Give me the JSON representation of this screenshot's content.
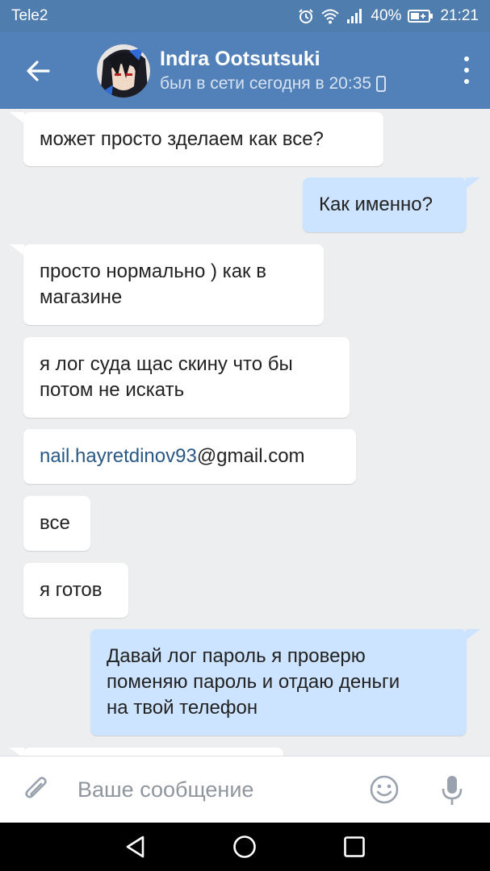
{
  "status": {
    "carrier": "Tele2",
    "battery": "40%",
    "time": "21:21"
  },
  "header": {
    "name": "Indra Ootsutsuki",
    "last_seen": "был в сети сегодня в 20:35"
  },
  "messages": [
    {
      "dir": "in",
      "lines": [
        "может просто зделаем как все?"
      ]
    },
    {
      "dir": "out",
      "lines": [
        "Как именно?"
      ]
    },
    {
      "dir": "in",
      "lines": [
        "просто нормально ) как в",
        "магазине"
      ]
    },
    {
      "dir": "in",
      "lines": [
        "я лог суда щас скину что бы",
        "потом не искать"
      ]
    },
    {
      "dir": "in",
      "link": "nail.hayretdinov93",
      "suffix": "@gmail.com"
    },
    {
      "dir": "in",
      "lines": [
        "все"
      ]
    },
    {
      "dir": "in",
      "lines": [
        "я готов"
      ]
    },
    {
      "dir": "out",
      "lines": [
        "Давай лог пароль я проверю",
        "поменяю пароль и отдаю деньги",
        "на твой телефон"
      ]
    }
  ],
  "composer": {
    "placeholder": "Ваше сообщение"
  },
  "colors": {
    "header": "#5181b8",
    "statusbar": "#4f7dae",
    "incoming": "#ffffff",
    "outgoing": "#cce4ff",
    "link": "#2a5885"
  },
  "icons": [
    "back-arrow-icon",
    "phone-icon",
    "more-vert-icon",
    "attach-icon",
    "emoji-icon",
    "mic-icon",
    "nav-back-icon",
    "nav-home-icon",
    "nav-recents-icon"
  ]
}
